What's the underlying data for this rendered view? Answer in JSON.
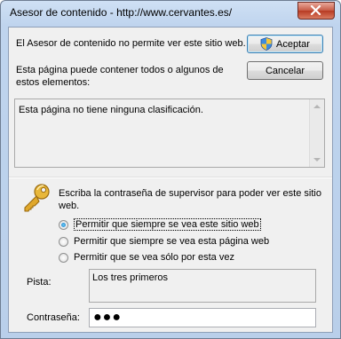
{
  "window": {
    "title": "Asesor de contenido - http://www.cervantes.es/"
  },
  "message": {
    "blocked": "El Asesor de contenido no permite ver este sitio web.",
    "description": "Esta página puede contener todos o algunos de estos elementos:",
    "rating_info": "Esta página no tiene ninguna clasificación."
  },
  "buttons": {
    "accept": "Aceptar",
    "cancel": "Cancelar"
  },
  "supervisor": {
    "prompt": "Escriba la contraseña de supervisor para poder ver este sitio web.",
    "options": [
      {
        "label": "Permitir que siempre se vea este sitio web",
        "checked": true
      },
      {
        "label": "Permitir que siempre se vea esta página web",
        "checked": false
      },
      {
        "label": "Permitir que se vea sólo por esta vez",
        "checked": false
      }
    ],
    "hint_label": "Pista:",
    "hint_value": "Los tres primeros",
    "password_label": "Contraseña:",
    "password_value": "●●●"
  },
  "icons": {
    "close": "close-icon",
    "shield": "uac-shield-icon",
    "key": "key-icon"
  }
}
